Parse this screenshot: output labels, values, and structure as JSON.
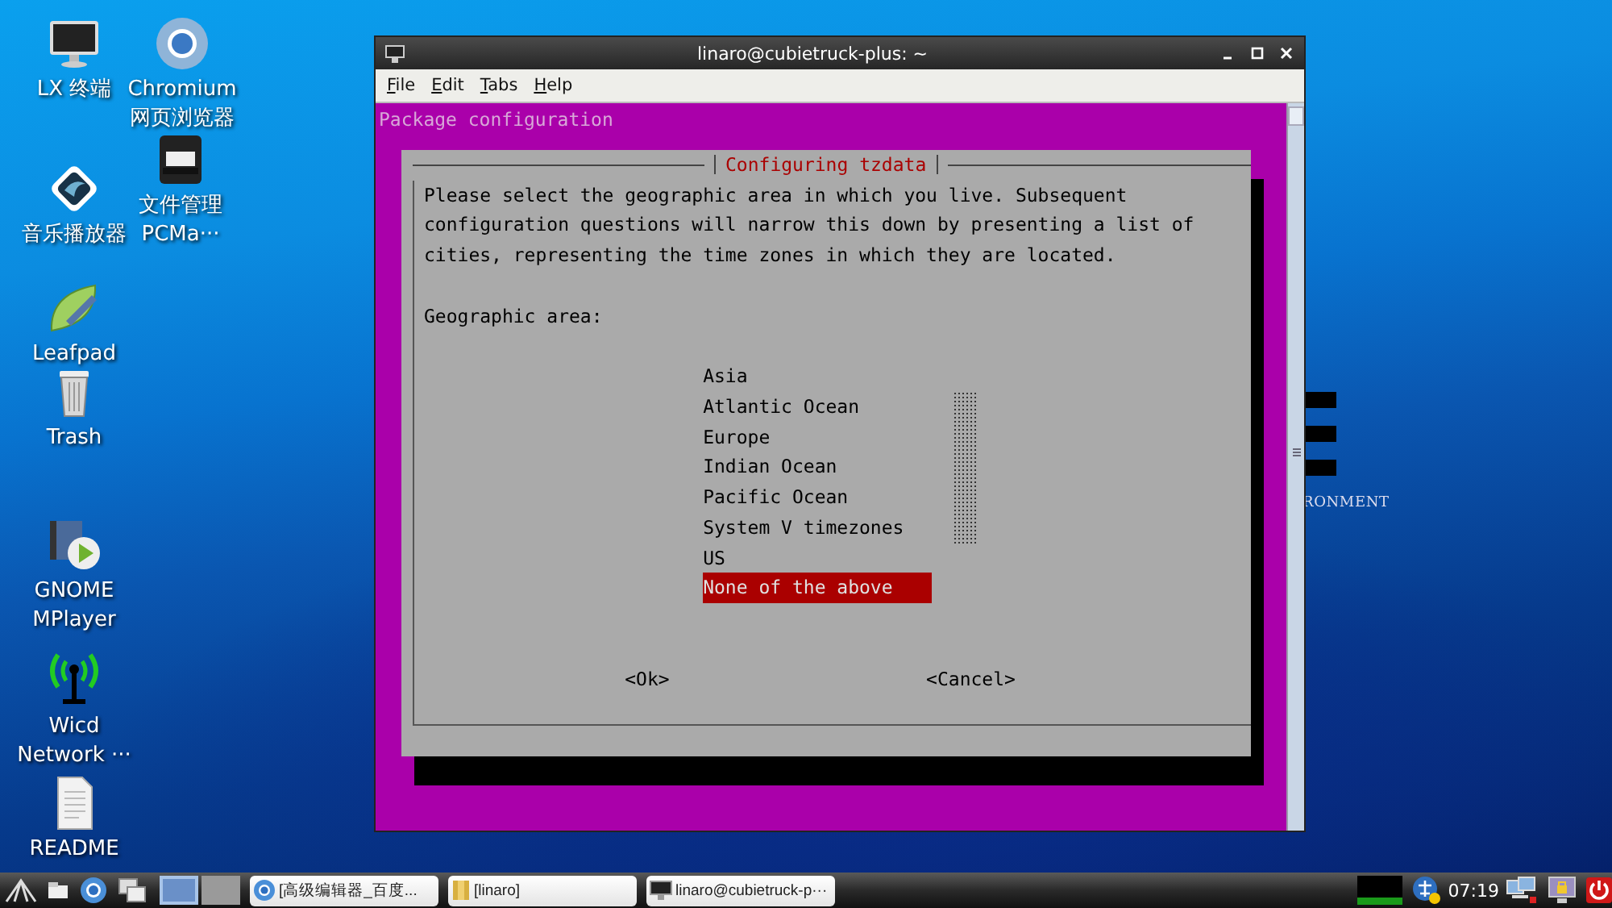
{
  "desktop_icons": [
    {
      "kind": "monitor",
      "label": "LX 终端"
    },
    {
      "kind": "music",
      "label": "音乐播放器"
    },
    {
      "kind": "leaf",
      "label": "Leafpad"
    },
    {
      "kind": "trash",
      "label": "Trash"
    },
    {
      "kind": "film",
      "label": "GNOME\nMPlayer"
    },
    {
      "kind": "antenna",
      "label": "Wicd\nNetwork ···"
    },
    {
      "kind": "document",
      "label": "README"
    },
    {
      "kind": "browser",
      "label": "Chromium\n网页浏览器"
    },
    {
      "kind": "cabinet",
      "label": "文件管理\nPCMa···"
    }
  ],
  "wallpaper_text": "RONMENT",
  "terminal": {
    "title": "linaro@cubietruck-plus: ~",
    "menu": [
      "File",
      "Edit",
      "Tabs",
      "Help"
    ],
    "header": "Package configuration",
    "dialog": {
      "title": "Configuring tzdata",
      "message": "Please select the geographic area in which you live. Subsequent configuration questions will narrow this down by presenting a list of cities, representing the time zones in which they are located.",
      "prompt": "Geographic area:",
      "options": [
        {
          "label": "Asia",
          "selected": false
        },
        {
          "label": "Atlantic Ocean",
          "selected": false
        },
        {
          "label": "Europe",
          "selected": false
        },
        {
          "label": "Indian Ocean",
          "selected": false
        },
        {
          "label": "Pacific Ocean",
          "selected": false
        },
        {
          "label": "System V timezones",
          "selected": false
        },
        {
          "label": "US",
          "selected": false
        },
        {
          "label": "None of the above",
          "selected": true
        }
      ],
      "buttons": [
        "<Ok>",
        "<Cancel>"
      ]
    }
  },
  "taskbar": {
    "desktops": [
      {
        "selected": true
      },
      {
        "selected": false
      }
    ],
    "tasks": [
      {
        "kind": "browser",
        "label": "[高级编辑器_百度..."
      },
      {
        "kind": "folder",
        "label": "[linaro]"
      },
      {
        "kind": "terminal",
        "label": "linaro@cubietruck-p···"
      }
    ],
    "clock": "07:19"
  }
}
